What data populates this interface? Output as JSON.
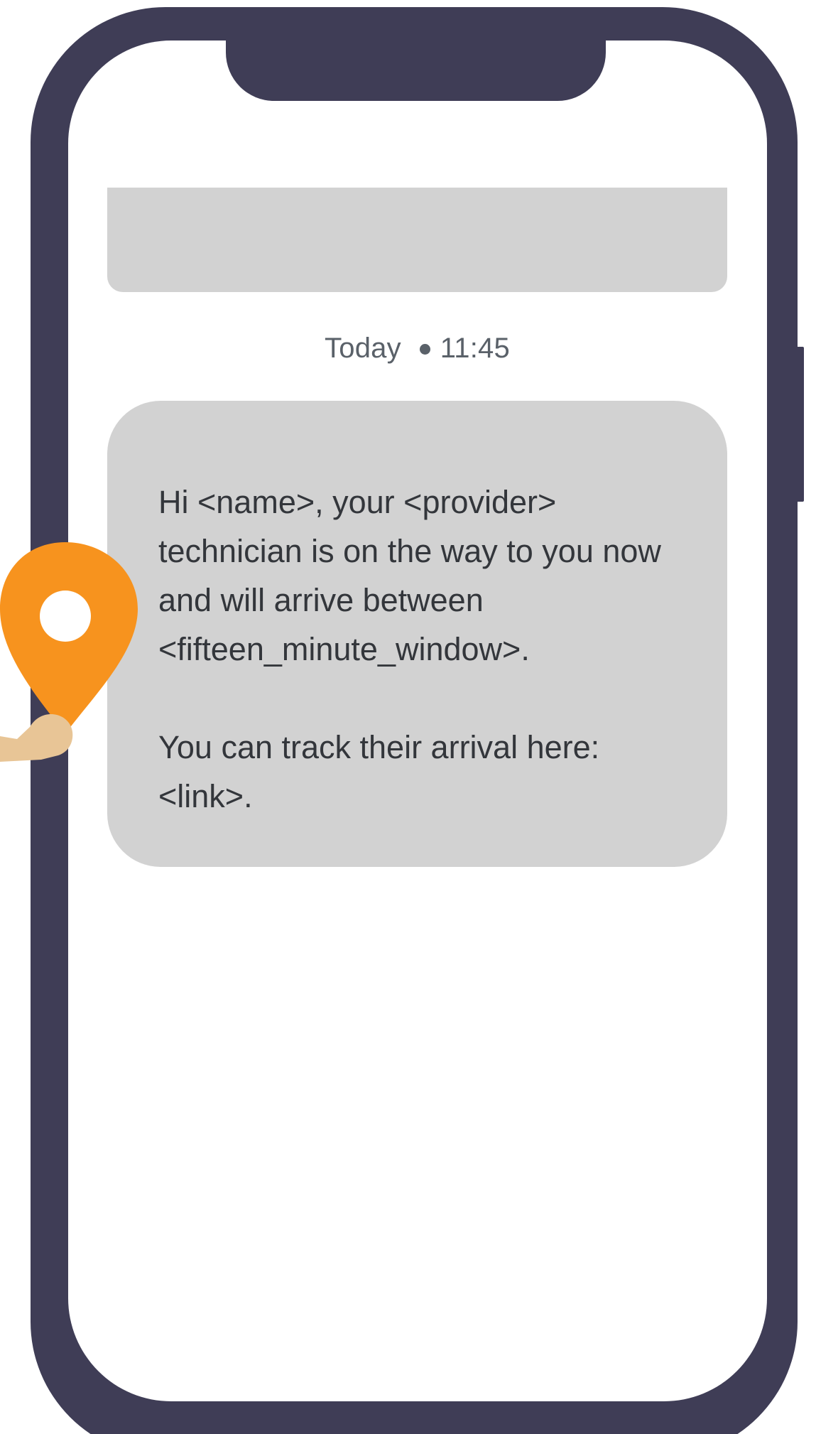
{
  "colors": {
    "phone_frame": "#3f3d56",
    "screen_background": "#ffffff",
    "bubble_background": "#d2d2d2",
    "message_text": "#33363b",
    "timestamp_text": "#5a6169",
    "pin": "#f7931e",
    "hand": "#e8c596"
  },
  "conversation": {
    "timestamp": {
      "day": "Today",
      "time": "11:45"
    },
    "message": {
      "paragraph_1": "Hi <name>, your <provider> technician is on the way to you now and will arrive between <fifteen_minute_window>.",
      "paragraph_2": "You can track their arrival here: <link>."
    }
  },
  "icons": {
    "pin": "location-pin-icon",
    "hand": "hand-icon"
  }
}
